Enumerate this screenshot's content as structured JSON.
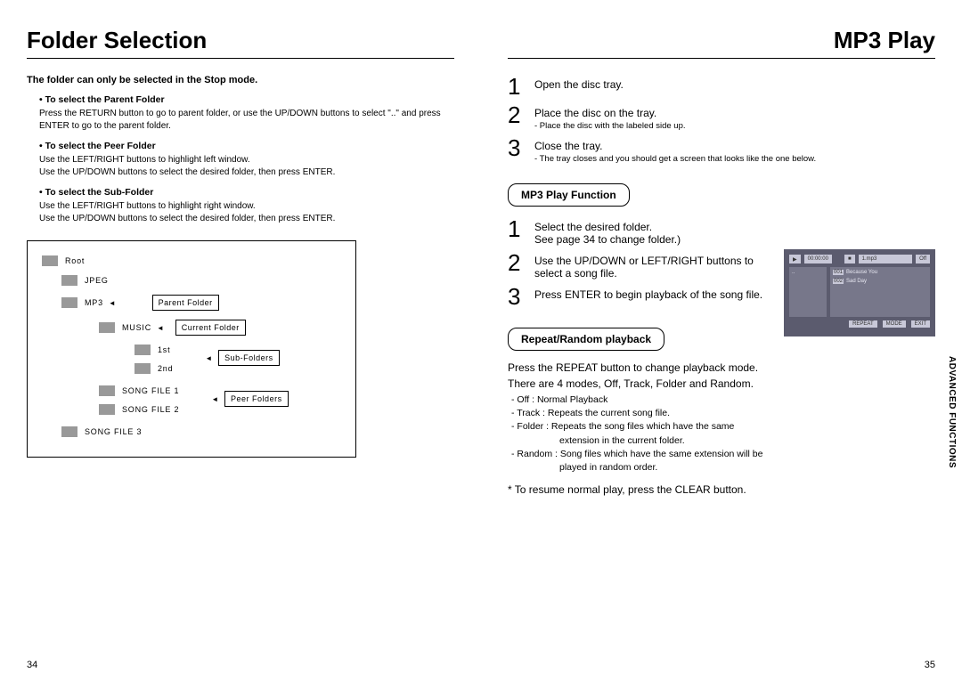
{
  "left": {
    "title": "Folder Selection",
    "intro": "The folder can only be selected in the Stop mode.",
    "sections": [
      {
        "heading": "• To select the Parent Folder",
        "body": "Press the RETURN button to go to parent folder, or use the UP/DOWN buttons to select \"..\" and press ENTER to go to the parent folder."
      },
      {
        "heading": "• To select the Peer Folder",
        "body1": "Use the LEFT/RIGHT buttons to highlight left window.",
        "body2": "Use the UP/DOWN buttons to select the desired folder, then press ENTER."
      },
      {
        "heading": "• To select the Sub-Folder",
        "body1": "Use the LEFT/RIGHT buttons to highlight right window.",
        "body2": "Use the UP/DOWN buttons to select the desired folder, then press ENTER."
      }
    ],
    "diagram": {
      "root": "Root",
      "jpeg": "JPEG",
      "mp3": "MP3",
      "parent": "Parent Folder",
      "music": "MUSIC",
      "current": "Current Folder",
      "first": "1st",
      "second": "2nd",
      "subfolders": "Sub-Folders",
      "song1": "SONG FILE 1",
      "song2": "SONG FILE 2",
      "song3": "SONG FILE 3",
      "peer": "Peer Folders"
    },
    "pagenum": "34"
  },
  "right": {
    "title": "MP3 Play",
    "steps1": [
      {
        "n": "1",
        "main": "Open the disc tray."
      },
      {
        "n": "2",
        "main": "Place the disc on the tray.",
        "note": "- Place the disc with the labeled side up."
      },
      {
        "n": "3",
        "main": "Close the tray.",
        "note": "- The tray closes and you should get a screen that looks like the one below."
      }
    ],
    "pill1": "MP3 Play Function",
    "steps2": [
      {
        "n": "1",
        "main": "Select the desired folder.",
        "main2": "See page 34 to change folder.)"
      },
      {
        "n": "2",
        "main": "Use the UP/DOWN or LEFT/RIGHT buttons to select a song file."
      },
      {
        "n": "3",
        "main": "Press ENTER to begin playback of the song file."
      }
    ],
    "pill2": "Repeat/Random playback",
    "rp": {
      "p1": "Press the REPEAT button to change playback mode.",
      "p2": "There are 4 modes, Off, Track, Folder and Random.",
      "l1": "- Off : Normal Playback",
      "l2": "- Track : Repeats the current song file.",
      "l3": "- Folder : Repeats the song files which have the same",
      "l3b": "extension in the current folder.",
      "l4": "- Random : Song files which have the same extension will be",
      "l4b": "played in random order.",
      "resume": "* To resume normal play, press the CLEAR button."
    },
    "screen": {
      "time": "00:00:00",
      "track": "1.mp3",
      "off": "Off",
      "r1n": "001",
      "r1": "Because You",
      "r2n": "002",
      "r2": "Sad Day",
      "b1": "REPEAT",
      "b2": "MODE",
      "b3": "EXIT"
    },
    "sidetab": "ADVANCED\nFUNCTIONS",
    "pagenum": "35"
  }
}
